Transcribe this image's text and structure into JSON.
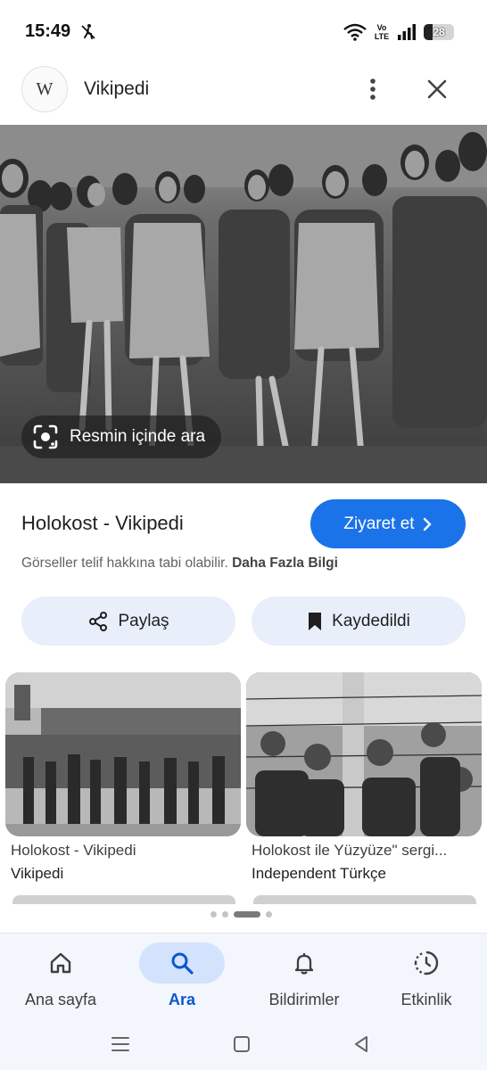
{
  "status_bar": {
    "time": "15:49",
    "battery": "28",
    "network_label": "Vo LTE",
    "icons": [
      "accessibility-off-icon",
      "wifi-icon",
      "volte-icon",
      "signal-icon",
      "battery-icon"
    ]
  },
  "header": {
    "logo_text": "W",
    "title": "Vikipedi",
    "icons": [
      "more-vert-icon",
      "close-icon"
    ]
  },
  "hero": {
    "lens_label": "Resmin içinde ara",
    "icon": "lens-icon"
  },
  "result": {
    "title": "Holokost - Vikipedi",
    "visit_label": "Ziyaret et",
    "copyright_text": "Görseller telif hakkına tabi olabilir.",
    "copyright_link": "Daha Fazla Bilgi"
  },
  "actions": {
    "share_label": "Paylaş",
    "save_label": "Kaydedildi"
  },
  "related": [
    {
      "title": "Holokost - Vikipedi",
      "source": "Vikipedi"
    },
    {
      "title": "Holokost ile Yüzyüze\" sergi...",
      "source": "Independent Türkçe"
    }
  ],
  "nav": {
    "items": [
      {
        "label": "Ana sayfa",
        "icon": "home-icon"
      },
      {
        "label": "Ara",
        "icon": "search-icon"
      },
      {
        "label": "Bildirimler",
        "icon": "bell-icon"
      },
      {
        "label": "Etkinlik",
        "icon": "activity-icon"
      }
    ],
    "active_index": 1
  },
  "colors": {
    "accent": "#1a73e8",
    "chip": "#e8eefa",
    "nav_active": "#d3e3fd",
    "nav_active_text": "#0b57d0"
  }
}
